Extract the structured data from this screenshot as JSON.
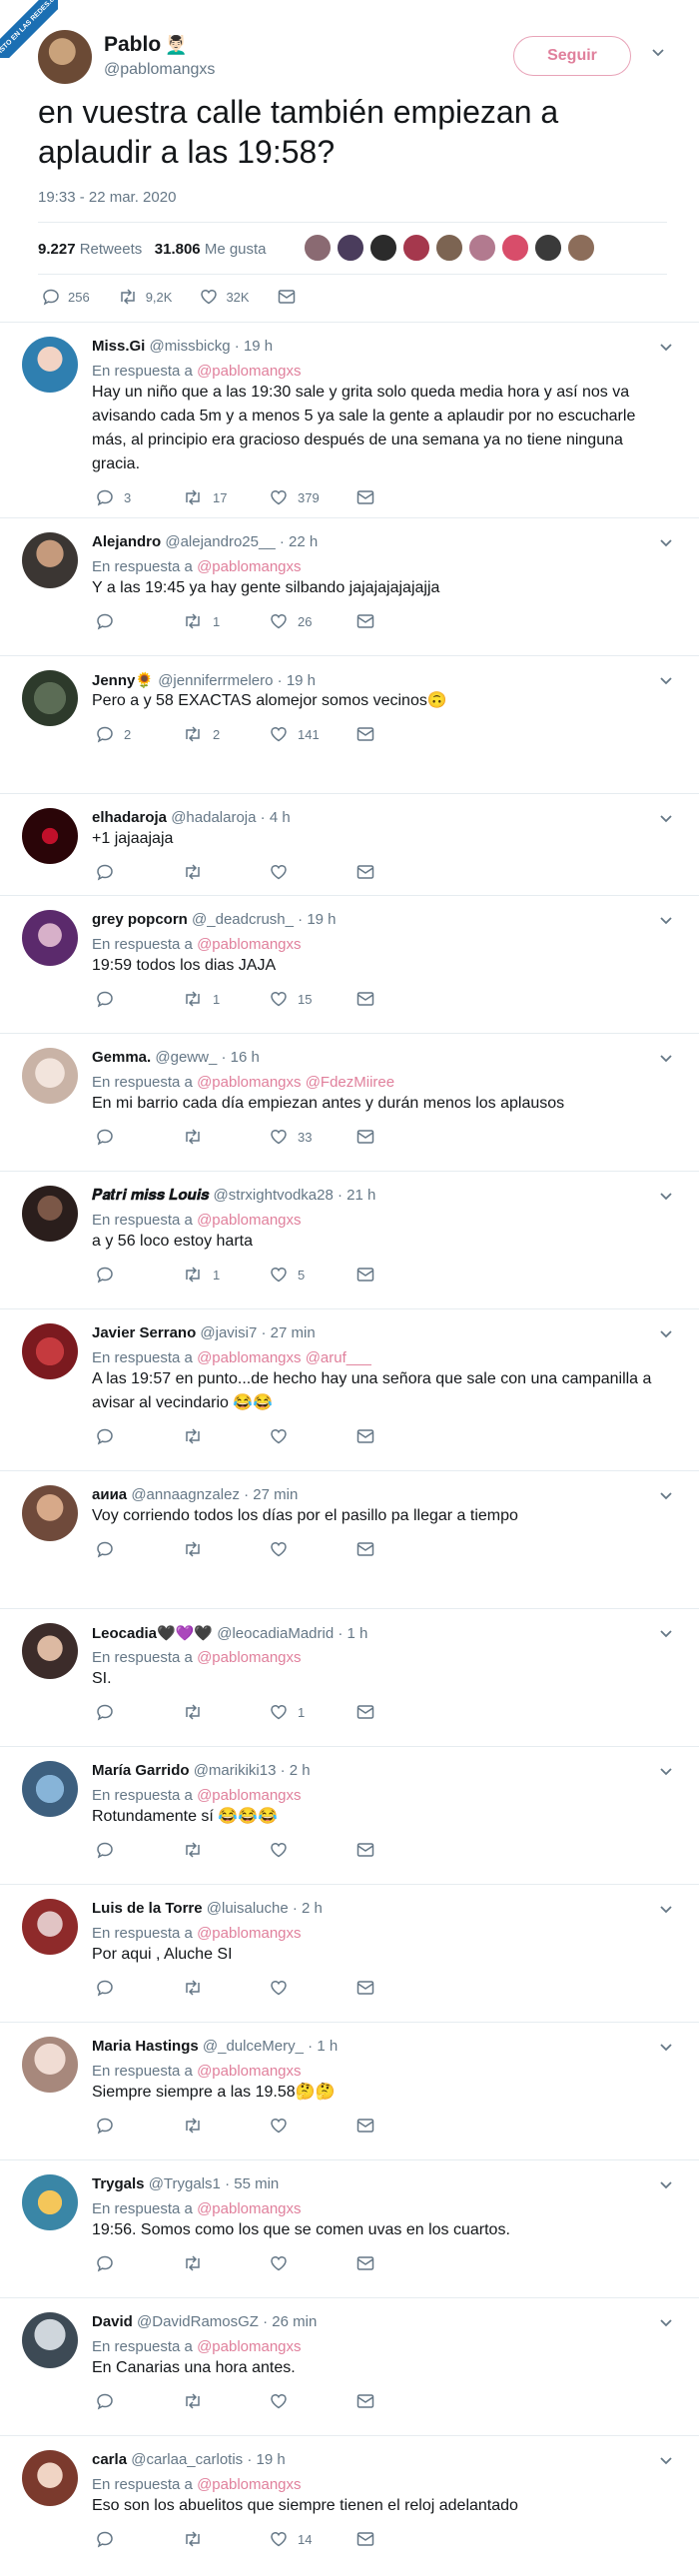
{
  "watermark": "VISTO EN LAS REDES.com",
  "main_tweet": {
    "name": "Pablo",
    "name_emoji": "💆🏻‍♂️",
    "handle": "@pablomangxs",
    "follow_label": "Seguir",
    "text": "en vuestra calle también empiezan a aplaudir a las 19:58?",
    "timestamp": "19:33 - 22 mar. 2020",
    "retweets_count": "9.227",
    "retweets_label": "Retweets",
    "likes_count": "31.806",
    "likes_label": "Me gusta",
    "reply_count": "256",
    "retweet_count_short": "9,2K",
    "like_count_short": "32K"
  },
  "colors": {
    "accent_pink": "#e0809c",
    "text_primary": "#14171a",
    "text_secondary": "#657786",
    "divider": "#e6ecf0"
  },
  "replies": [
    {
      "name": "Miss.Gi",
      "handle": "@missbickg",
      "time": "· 19 h",
      "in_reply_prefix": "En respuesta a",
      "in_reply_to": "@pablomangxs",
      "text": "Hay un niño que a las 19:30 sale y grita solo queda media hora y así nos va avisando cada 5m y a menos 5 ya sale la gente a aplaudir por no escucharle más, al principio era gracioso después de una semana ya no tiene ninguna gracia.",
      "replies": "3",
      "retweets": "17",
      "likes": "379"
    },
    {
      "name": "Alejandro",
      "handle": "@alejandro25__",
      "time": "· 22 h",
      "in_reply_prefix": "En respuesta a",
      "in_reply_to": "@pablomangxs",
      "text": "Y a las 19:45 ya hay gente silbando jajajajajajajja",
      "replies": "",
      "retweets": "1",
      "likes": "26"
    },
    {
      "name": "Jenny🌻",
      "handle": "@jenniferrmelero",
      "time": "· 19 h",
      "in_reply_prefix": "",
      "in_reply_to": "",
      "text": "Pero a y 58 EXACTAS alomejor somos vecinos🙃",
      "replies": "2",
      "retweets": "2",
      "likes": "141"
    },
    {
      "name": "elhadaroja",
      "handle": "@hadalaroja",
      "time": "· 4 h",
      "in_reply_prefix": "",
      "in_reply_to": "",
      "text": "+1 jajaajaja",
      "replies": "",
      "retweets": "",
      "likes": ""
    },
    {
      "name": "grey popcorn",
      "handle": "@_deadcrush_",
      "time": "· 19 h",
      "in_reply_prefix": "En respuesta a",
      "in_reply_to": "@pablomangxs",
      "text": "19:59 todos los dias JAJA",
      "replies": "",
      "retweets": "1",
      "likes": "15"
    },
    {
      "name": "Gemma.",
      "handle": "@geww_",
      "time": "· 16 h",
      "in_reply_prefix": "En respuesta a",
      "in_reply_to": "@pablomangxs @FdezMiiree",
      "text": "En mi barrio cada día empiezan antes y durán menos los aplausos",
      "replies": "",
      "retweets": "",
      "likes": "33"
    },
    {
      "name": "𝑷𝒂𝒕𝒓𝒊 𝒎𝒊𝒔𝒔 𝑳𝒐𝒖𝒊𝒔",
      "handle": "@strxightvodka28",
      "time": "· 21 h",
      "in_reply_prefix": "En respuesta a",
      "in_reply_to": "@pablomangxs",
      "text": "a y 56 loco estoy harta",
      "replies": "",
      "retweets": "1",
      "likes": "5"
    },
    {
      "name": "Javier Serrano",
      "handle": "@javisi7",
      "time": "· 27 min",
      "in_reply_prefix": "En respuesta a",
      "in_reply_to": "@pablomangxs @aruf___",
      "text": "A las 19:57 en punto...de hecho hay una señora que sale con una campanilla a avisar al vecindario 😂😂",
      "replies": "",
      "retweets": "",
      "likes": ""
    },
    {
      "name": "аииа",
      "handle": "@annaagnzalez",
      "time": "· 27 min",
      "in_reply_prefix": "",
      "in_reply_to": "",
      "text": "Voy corriendo todos los días por el pasillo pa llegar a tiempo",
      "replies": "",
      "retweets": "",
      "likes": ""
    },
    {
      "name": "Leocadia🖤💜🖤",
      "handle": "@leocadiaMadrid",
      "time": "· 1 h",
      "in_reply_prefix": "En respuesta a",
      "in_reply_to": "@pablomangxs",
      "text": "SI.",
      "replies": "",
      "retweets": "",
      "likes": "1"
    },
    {
      "name": "María Garrido",
      "handle": "@marikiki13",
      "time": "· 2 h",
      "in_reply_prefix": "En respuesta a",
      "in_reply_to": "@pablomangxs",
      "text": "Rotundamente sí 😂😂😂",
      "replies": "",
      "retweets": "",
      "likes": ""
    },
    {
      "name": "Luis de la Torre",
      "handle": "@luisaluche",
      "time": "· 2 h",
      "in_reply_prefix": "En respuesta a",
      "in_reply_to": "@pablomangxs",
      "text": "Por aqui , Aluche SI",
      "replies": "",
      "retweets": "",
      "likes": ""
    },
    {
      "name": "Maria Hastings",
      "handle": "@_dulceMery_",
      "time": "· 1 h",
      "in_reply_prefix": "En respuesta a",
      "in_reply_to": "@pablomangxs",
      "text": "Siempre siempre a las 19.58🤔🤔",
      "replies": "",
      "retweets": "",
      "likes": ""
    },
    {
      "name": "Trygals",
      "handle": "@Trygals1",
      "time": "· 55 min",
      "in_reply_prefix": "En respuesta a",
      "in_reply_to": "@pablomangxs",
      "text": "19:56. Somos como los que se comen uvas en los cuartos.",
      "replies": "",
      "retweets": "",
      "likes": ""
    },
    {
      "name": "David",
      "handle": "@DavidRamosGZ",
      "time": "· 26 min",
      "in_reply_prefix": "En respuesta a",
      "in_reply_to": "@pablomangxs",
      "text": "En Canarias una hora antes.",
      "replies": "",
      "retweets": "",
      "likes": ""
    },
    {
      "name": "carla",
      "handle": "@carlaa_carlotis",
      "time": "· 19 h",
      "in_reply_prefix": "En respuesta a",
      "in_reply_to": "@pablomangxs",
      "text": "Eso son los abuelitos que siempre tienen el reloj adelantado",
      "replies": "",
      "retweets": "",
      "likes": "14"
    }
  ]
}
